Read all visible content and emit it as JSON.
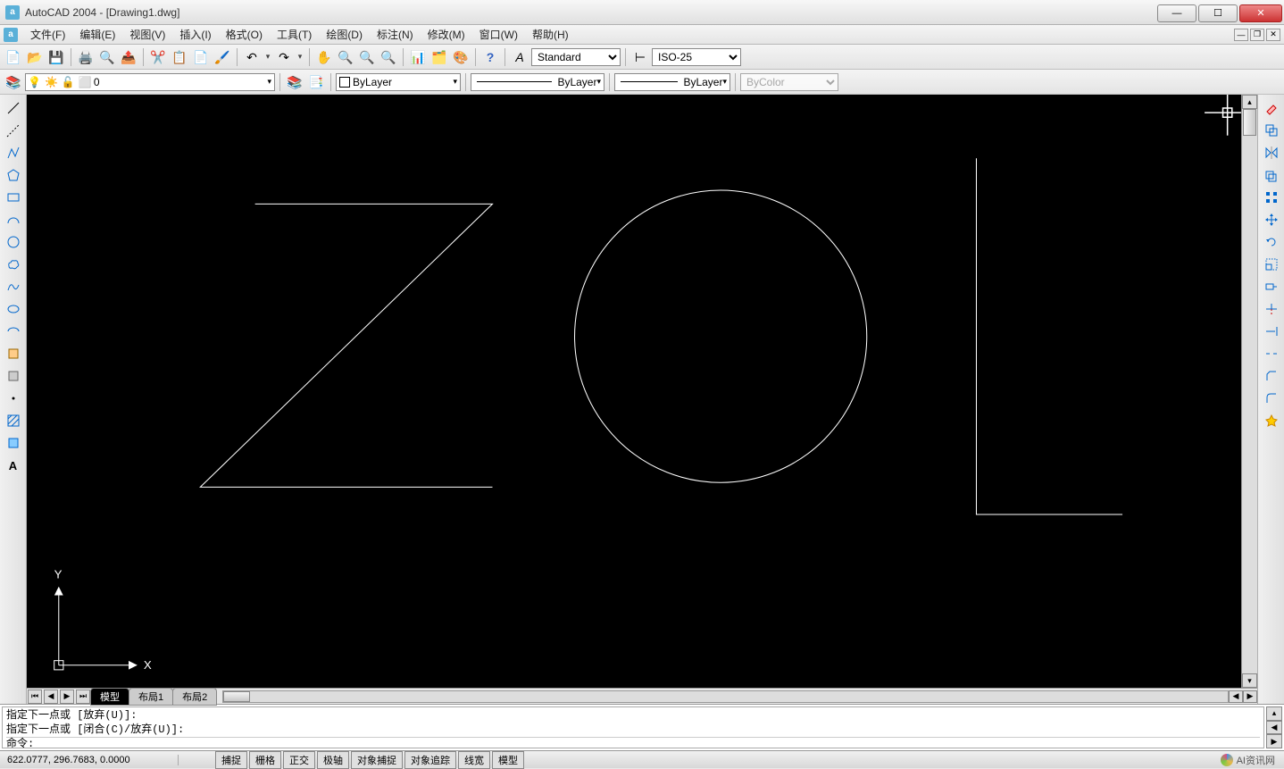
{
  "app": {
    "title": "AutoCAD 2004 - [Drawing1.dwg]",
    "icon_letter": "a"
  },
  "menus": [
    "文件(F)",
    "编辑(E)",
    "视图(V)",
    "插入(I)",
    "格式(O)",
    "工具(T)",
    "绘图(D)",
    "标注(N)",
    "修改(M)",
    "窗口(W)",
    "帮助(H)"
  ],
  "toolbar1": {
    "text_style_label": "Standard",
    "dim_style_label": "ISO-25"
  },
  "toolbar2": {
    "layer_value": "0",
    "linetype": "ByLayer",
    "lineweight": "ByLayer",
    "plot_style": "ByLayer",
    "color_label": "ByColor"
  },
  "layout_tabs": {
    "active": "模型",
    "others": [
      "布局1",
      "布局2"
    ]
  },
  "command": {
    "line1": "指定下一点或 [放弃(U)]:",
    "line2": "指定下一点或 [闭合(C)/放弃(U)]:",
    "prompt": "命令:"
  },
  "status": {
    "coords": "622.0777, 296.7683, 0.0000",
    "buttons": [
      "捕捉",
      "栅格",
      "正交",
      "极轴",
      "对象捕捉",
      "对象追踪",
      "线宽",
      "模型"
    ],
    "watermark": "AI资讯网"
  },
  "ucs": {
    "x": "X",
    "y": "Y"
  }
}
